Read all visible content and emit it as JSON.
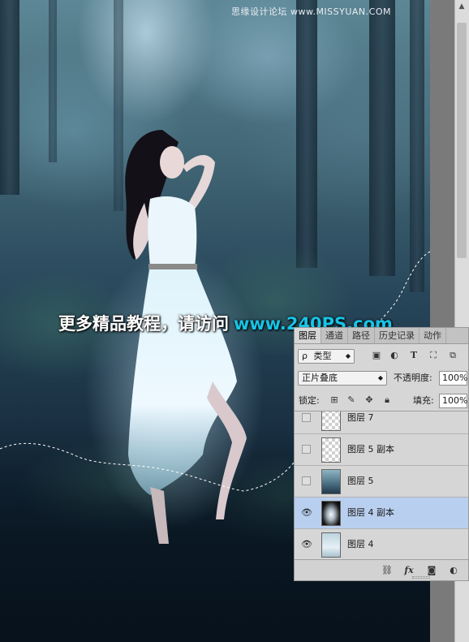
{
  "watermark": {
    "site_top": "思缘设计论坛 www.MISSYUAN.COM",
    "promo_text": "更多精品教程，请访问",
    "promo_url": "www.240PS.com"
  },
  "layers_panel": {
    "tabs": [
      {
        "label": "图层",
        "active": true
      },
      {
        "label": "通道",
        "active": false
      },
      {
        "label": "路径",
        "active": false
      },
      {
        "label": "历史记录",
        "active": false
      },
      {
        "label": "动作",
        "active": false
      }
    ],
    "filter": {
      "search_glyph": "ρ",
      "kind_label": "类型"
    },
    "filter_icons": [
      "image-filter-icon",
      "adjustment-filter-icon",
      "type-filter-icon",
      "shape-filter-icon",
      "smart-object-filter-icon"
    ],
    "blend_mode": "正片叠底",
    "opacity_label": "不透明度:",
    "opacity_value": "100%",
    "lock_label": "锁定:",
    "fill_label": "填充:",
    "fill_value": "100%",
    "layers": [
      {
        "name": "图层 7",
        "visible": false,
        "selected": false,
        "thumb": "transparent"
      },
      {
        "name": "图层 5 副本",
        "visible": false,
        "selected": false,
        "thumb": "transparent"
      },
      {
        "name": "图层 5",
        "visible": false,
        "selected": false,
        "thumb": "photo"
      },
      {
        "name": "图层 4 副本",
        "visible": true,
        "selected": true,
        "thumb": "dark"
      },
      {
        "name": "图层 4",
        "visible": true,
        "selected": false,
        "thumb": "light"
      }
    ],
    "footer_icons": [
      "link-layers-icon",
      "fx-icon",
      "add-mask-icon",
      "adjustment-layer-icon"
    ],
    "footer_fx_label": "fx"
  },
  "colors": {
    "accent_url": "#17c4e6",
    "selected_layer": "#b9cff0"
  }
}
